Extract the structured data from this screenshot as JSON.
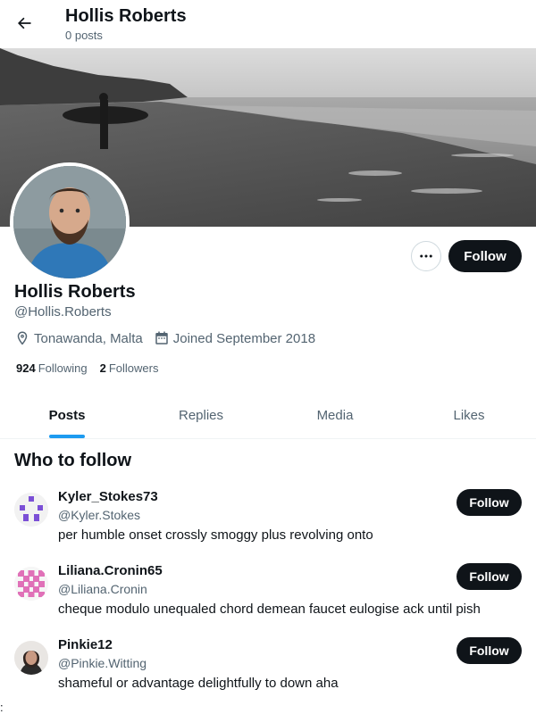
{
  "header": {
    "title": "Hollis Roberts",
    "post_count": "0 posts"
  },
  "profile": {
    "display_name": "Hollis Roberts",
    "handle": "@Hollis.Roberts",
    "location": "Tonawanda, Malta",
    "joined": "Joined September 2018",
    "following_count": "924",
    "following_label": "Following",
    "followers_count": "2",
    "followers_label": "Followers",
    "follow_label": "Follow"
  },
  "tabs": [
    {
      "label": "Posts",
      "active": true
    },
    {
      "label": "Replies",
      "active": false
    },
    {
      "label": "Media",
      "active": false
    },
    {
      "label": "Likes",
      "active": false
    }
  ],
  "who_to_follow": {
    "title": "Who to follow",
    "items": [
      {
        "name": "Kyler_Stokes73",
        "handle": "@Kyler.Stokes",
        "bio": "per humble onset crossly smoggy plus revolving onto",
        "follow_label": "Follow"
      },
      {
        "name": "Liliana.Cronin65",
        "handle": "@Liliana.Cronin",
        "bio": "cheque modulo unequaled chord demean faucet eulogise ack until pish",
        "follow_label": "Follow"
      },
      {
        "name": "Pinkie12",
        "handle": "@Pinkie.Witting",
        "bio": "shameful or advantage delightfully to down aha",
        "follow_label": "Follow"
      }
    ]
  },
  "icons": {
    "back": "arrow-left-icon",
    "more": "ellipsis-icon",
    "location": "location-pin-icon",
    "calendar": "calendar-icon"
  },
  "colors": {
    "accent": "#1d9bf0",
    "text": "#0f1419",
    "secondary": "#536471",
    "button": "#0f1419"
  },
  "stray_glyph": ":"
}
